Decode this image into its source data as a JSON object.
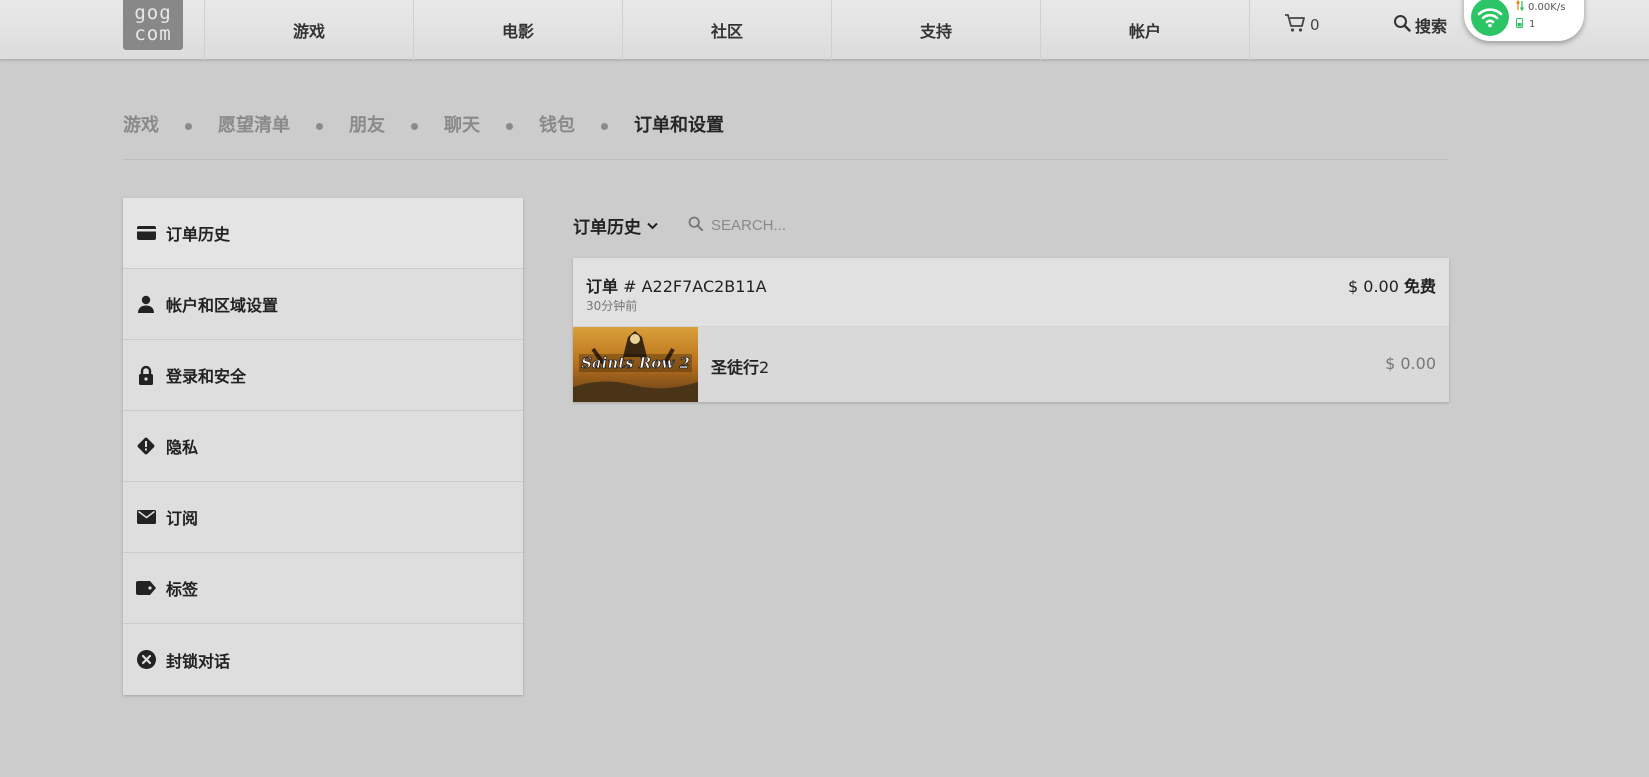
{
  "logo": {
    "line1": "gog",
    "line2": "com"
  },
  "nav": {
    "items": [
      {
        "label": "游戏"
      },
      {
        "label": "电影"
      },
      {
        "label": "社区"
      },
      {
        "label": "支持"
      },
      {
        "label": "帐户"
      }
    ],
    "cart_count": "0",
    "search_label": "搜索"
  },
  "net_widget": {
    "speed": "0.00K/s",
    "count": "1",
    "accent": "#2cc566"
  },
  "subtabs": {
    "items": [
      {
        "label": "游戏"
      },
      {
        "label": "愿望清单"
      },
      {
        "label": "朋友"
      },
      {
        "label": "聊天"
      },
      {
        "label": "钱包"
      },
      {
        "label": "订单和设置"
      }
    ],
    "active": "订单和设置"
  },
  "sidebar": {
    "items": [
      {
        "label": "订单历史",
        "icon": "credit-card-icon"
      },
      {
        "label": "帐户和区域设置",
        "icon": "user-icon"
      },
      {
        "label": "登录和安全",
        "icon": "lock-icon"
      },
      {
        "label": "隐私",
        "icon": "warning-diamond-icon"
      },
      {
        "label": "订阅",
        "icon": "envelope-icon"
      },
      {
        "label": "标签",
        "icon": "tag-icon"
      },
      {
        "label": "封锁对话",
        "icon": "block-icon"
      }
    ]
  },
  "main": {
    "filter_label": "订单历史",
    "search_placeholder": "SEARCH...",
    "order": {
      "id_prefix": "订单",
      "id": "# A22F7AC2B11A",
      "time": "30分钟前",
      "total": "$ 0.00",
      "total_note": "免费",
      "line": {
        "title_cn": "圣徒行",
        "title_num": "2",
        "price": "$ 0.00",
        "cover_text": "Saints Row 2"
      }
    }
  }
}
